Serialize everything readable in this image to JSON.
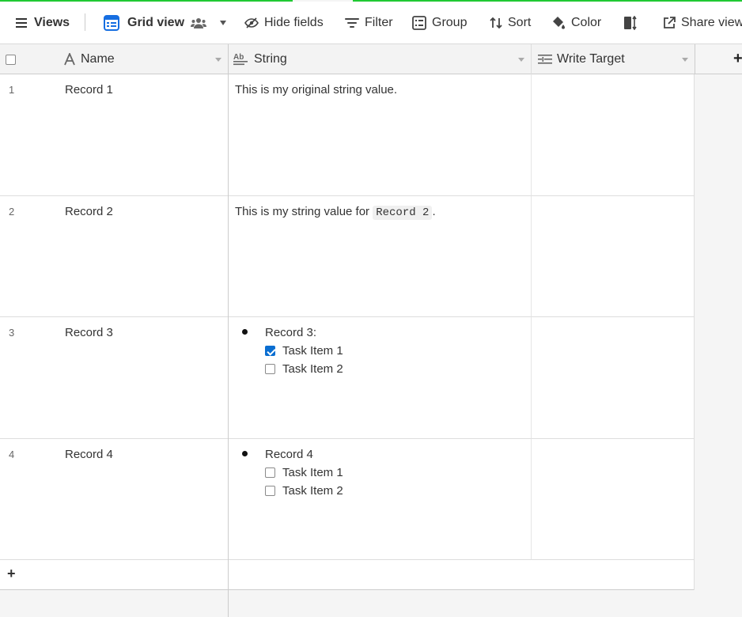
{
  "toolbar": {
    "views_label": "Views",
    "view_name": "Grid view",
    "hide_fields_label": "Hide fields",
    "filter_label": "Filter",
    "group_label": "Group",
    "sort_label": "Sort",
    "color_label": "Color",
    "share_label": "Share view"
  },
  "columns": {
    "name": "Name",
    "string": "String",
    "write_target": "Write Target",
    "add_symbol": "+"
  },
  "rows": [
    {
      "num": "1",
      "name": "Record 1",
      "string": "This is my original string value."
    },
    {
      "num": "2",
      "name": "Record 2",
      "string_prefix": "This is my string value for ",
      "string_code": "Record 2",
      "string_suffix": "."
    },
    {
      "num": "3",
      "name": "Record 3",
      "bullet": "Record 3:",
      "tasks": [
        {
          "label": "Task Item 1",
          "checked": true
        },
        {
          "label": "Task Item 2",
          "checked": false
        }
      ]
    },
    {
      "num": "4",
      "name": "Record 4",
      "bullet": "Record 4",
      "tasks": [
        {
          "label": "Task Item 1",
          "checked": false
        },
        {
          "label": "Task Item 2",
          "checked": false
        }
      ]
    }
  ],
  "add_row_symbol": "+",
  "colors": {
    "accent": "#0a6ed1",
    "progress": "#20c933",
    "grid_icon": "#166ee1"
  }
}
